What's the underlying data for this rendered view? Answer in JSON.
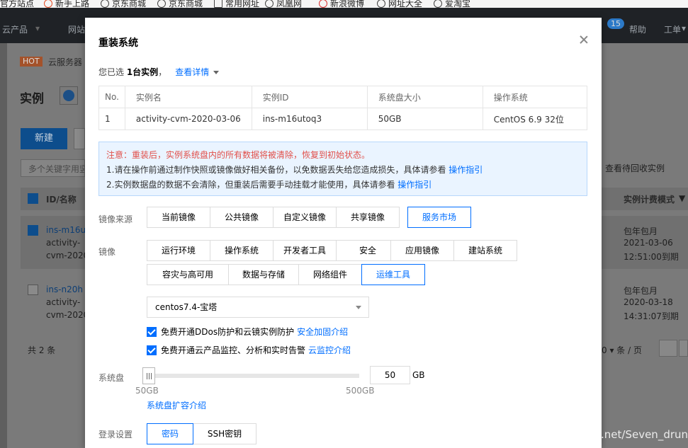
{
  "bookmarks": [
    "官方站点",
    "新手上路",
    "京东商城",
    "京东商城",
    "常用网址",
    "凤凰网",
    "新浪微博",
    "网址大全",
    "爱淘宝"
  ],
  "topnav": {
    "products": "云产品",
    "website": "网站",
    "badge": "15",
    "help": "帮助",
    "ticket": "工单"
  },
  "background": {
    "hot": "HOT",
    "hot_text": "云服务器",
    "page_title": "实例",
    "new_button": "新建",
    "search_placeholder": "多个关键字用竖",
    "col_id_name": "ID/名称",
    "row1_id": "ins-m16u",
    "row1_name_a": "activity-",
    "row1_name_b": "cvm-2020",
    "row2_id": "ins-n20h",
    "row2_name_a": "activity-",
    "row2_name_b": "cvm-2020",
    "footer_total": "共 2 条",
    "recycle_link": "查看待回收实例",
    "billing_col": "实例计费模式",
    "row1_billing": "包年包月",
    "row1_date": "2021-03-06",
    "row1_expire": "12:51:00到期",
    "row2_billing": "包年包月",
    "row2_date": "2020-03-18",
    "row2_expire": "14:31:07到期",
    "per_page": "0 ▾ 条 / 页"
  },
  "modal": {
    "title": "重装系统",
    "selected_prefix": "您已选 ",
    "selected_count": "1台实例",
    "selected_suffix": "，",
    "view_details": "查看详情",
    "table": {
      "headers": [
        "No.",
        "实例名",
        "实例ID",
        "系统盘大小",
        "操作系统"
      ],
      "rows": [
        [
          "1",
          "activity-cvm-2020-03-06",
          "ins-m16utoq3",
          "50GB",
          "CentOS 6.9 32位"
        ]
      ]
    },
    "warning": {
      "line1": "注意：重装后，实例系统盘内的所有数据将被清除，恢复到初始状态。",
      "line2_text": "1.请在操作前通过制作快照或镜像做好相关备份，以免数据丢失给您造成损失，具体请参看 ",
      "line2_link": "操作指引",
      "line3_text": "2.实例数据盘的数据不会清除，但重装后需要手动挂载才能使用，具体请参看 ",
      "line3_link": "操作指引"
    },
    "image_source_label": "镜像来源",
    "image_sources": [
      "当前镜像",
      "公共镜像",
      "自定义镜像",
      "共享镜像",
      "服务市场"
    ],
    "image_label": "镜像",
    "image_categories_row1": [
      "运行环境",
      "操作系统",
      "开发者工具",
      "安全",
      "应用镜像",
      "建站系统"
    ],
    "image_categories_row2": [
      "容灾与高可用",
      "数据与存储",
      "网络组件",
      "运维工具"
    ],
    "selected_image": "centos7.4-宝塔",
    "check1_text": "免费开通DDos防护和云镜实例防护",
    "check1_link": "安全加固介绍",
    "check2_text": "免费开通云产品监控、分析和实时告警",
    "check2_link": "云监控介绍",
    "system_disk_label": "系统盘",
    "disk_min": "50GB",
    "disk_max": "500GB",
    "disk_value": "50",
    "disk_unit": "GB",
    "disk_level_fraction": 0,
    "disk_expand_link": "系统盘扩容介绍",
    "login_label": "登录设置",
    "login_options": [
      "密码",
      "SSH密钥"
    ]
  },
  "watermark": "https://blog.csdn.net/Seven_drunk",
  "colors": {
    "accent": "#006eff",
    "warning_red": "#e1504a",
    "info_bg": "#eaf4ff"
  }
}
